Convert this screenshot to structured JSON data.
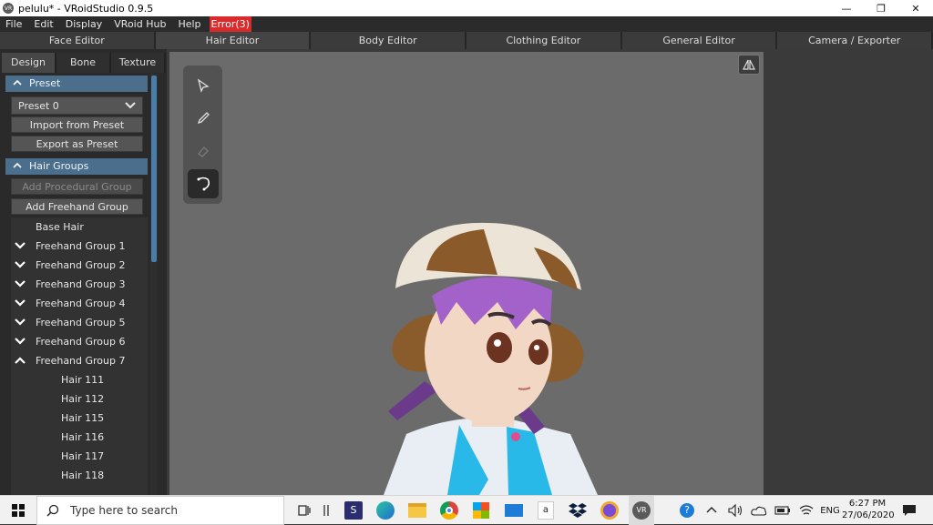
{
  "window": {
    "title": "pelulu* - VRoidStudio 0.9.5",
    "app_icon_text": "VR",
    "controls": {
      "minimize": "—",
      "restore": "❐",
      "close": "✕"
    }
  },
  "menu": {
    "items": [
      "File",
      "Edit",
      "Display",
      "VRoid Hub",
      "Help"
    ],
    "error_label": "Error(3)"
  },
  "editor_tabs": [
    {
      "label": "Face Editor",
      "active": false
    },
    {
      "label": "Hair Editor",
      "active": true
    },
    {
      "label": "Body Editor",
      "active": false
    },
    {
      "label": "Clothing Editor",
      "active": false
    },
    {
      "label": "General Editor",
      "active": false
    },
    {
      "label": "Camera / Exporter",
      "active": false
    }
  ],
  "sub_tabs": [
    {
      "label": "Design",
      "active": true
    },
    {
      "label": "Bone",
      "active": false
    },
    {
      "label": "Texture",
      "active": false
    }
  ],
  "preset_section": {
    "header": "Preset",
    "selected": "Preset 0",
    "import_label": "Import from Preset",
    "export_label": "Export as Preset"
  },
  "hair_groups_section": {
    "header": "Hair Groups",
    "add_procedural_label": "Add Procedural Group",
    "add_freehand_label": "Add Freehand Group",
    "items": [
      {
        "label": "Base Hair",
        "arrow": "none"
      },
      {
        "label": "Freehand Group 1",
        "arrow": "down"
      },
      {
        "label": "Freehand Group 2",
        "arrow": "down"
      },
      {
        "label": "Freehand Group 3",
        "arrow": "down"
      },
      {
        "label": "Freehand Group 4",
        "arrow": "down"
      },
      {
        "label": "Freehand Group 5",
        "arrow": "down"
      },
      {
        "label": "Freehand Group 6",
        "arrow": "down"
      },
      {
        "label": "Freehand Group 7",
        "arrow": "up"
      },
      {
        "label": "Hair 111",
        "arrow": "child"
      },
      {
        "label": "Hair 112",
        "arrow": "child"
      },
      {
        "label": "Hair 115",
        "arrow": "child"
      },
      {
        "label": "Hair 116",
        "arrow": "child"
      },
      {
        "label": "Hair 117",
        "arrow": "child"
      },
      {
        "label": "Hair 118",
        "arrow": "child"
      }
    ]
  },
  "tools": [
    "select-icon",
    "pen-icon",
    "eraser-icon",
    "lasso-icon"
  ],
  "taskbar": {
    "search_placeholder": "Type here to search",
    "language": "ENG",
    "time": "6:27 PM",
    "date": "27/06/2020"
  },
  "colors": {
    "accent": "#4b6e8c",
    "error": "#d92b2b",
    "viewport": "#6b6b6b"
  }
}
